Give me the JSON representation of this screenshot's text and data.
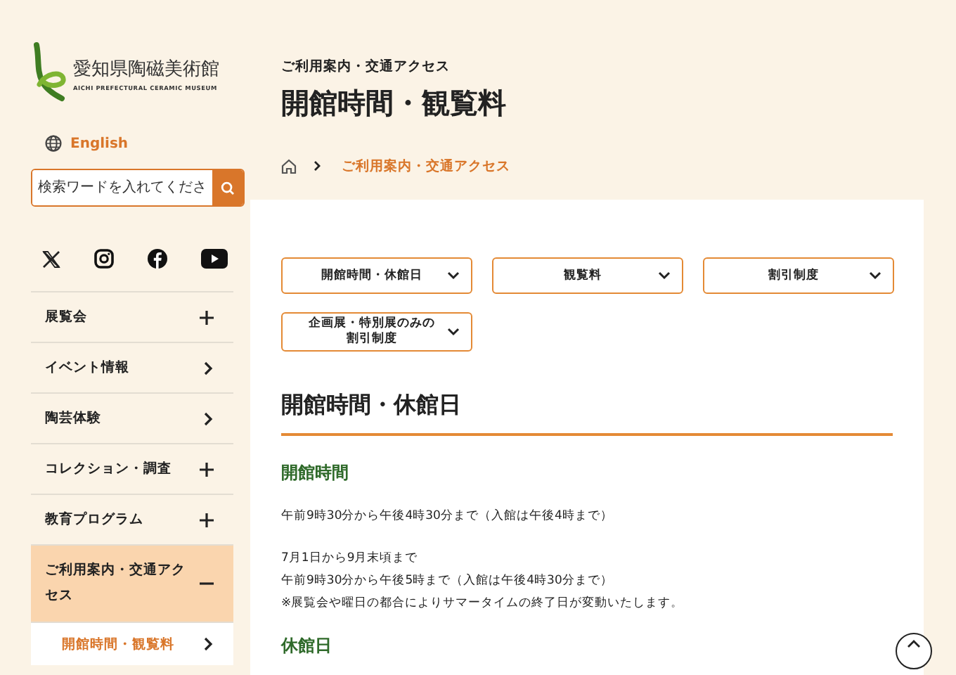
{
  "logo": {
    "name": "愛知県陶磁美術館",
    "subtitle": "AICHI PREFECTURAL CERAMIC MUSEUM"
  },
  "language_link": "English",
  "search": {
    "placeholder": "検索ワードを入れてくださ"
  },
  "menu": [
    {
      "label": "展覧会",
      "kind": "expandable",
      "expanded": false,
      "selected": false
    },
    {
      "label": "イベント情報",
      "kind": "link",
      "selected": false
    },
    {
      "label": "陶芸体験",
      "kind": "link",
      "selected": false
    },
    {
      "label": "コレクション・調査",
      "kind": "expandable",
      "expanded": false,
      "selected": false
    },
    {
      "label": "教育プログラム",
      "kind": "expandable",
      "expanded": false,
      "selected": false
    },
    {
      "label": "ご利用案内・交通アクセス",
      "kind": "expandable",
      "expanded": true,
      "selected": true,
      "children": [
        {
          "label": "開館時間・観覧料",
          "selected": true
        }
      ]
    }
  ],
  "page": {
    "category": "ご利用案内・交通アクセス",
    "title": "開館時間・観覧料"
  },
  "breadcrumb": {
    "current": "ご利用案内・交通アクセス"
  },
  "anchors": [
    "開館時間・休館日",
    "観覧料",
    "割引制度",
    "企画展・特別展のみの割引制度"
  ],
  "section": {
    "heading": "開館時間・休館日",
    "subsections": [
      {
        "heading": "開館時間",
        "paragraphs": [
          [
            "午前9時30分から午後4時30分まで（入館は午後4時まで）"
          ],
          [
            "7月1日から9月末頃まで",
            "午前9時30分から午後5時まで（入館は午後4時30分まで）",
            "※展覧会や曜日の都合によりサマータイムの終了日が変動いたします。"
          ]
        ]
      },
      {
        "heading": "休館日"
      }
    ]
  }
}
